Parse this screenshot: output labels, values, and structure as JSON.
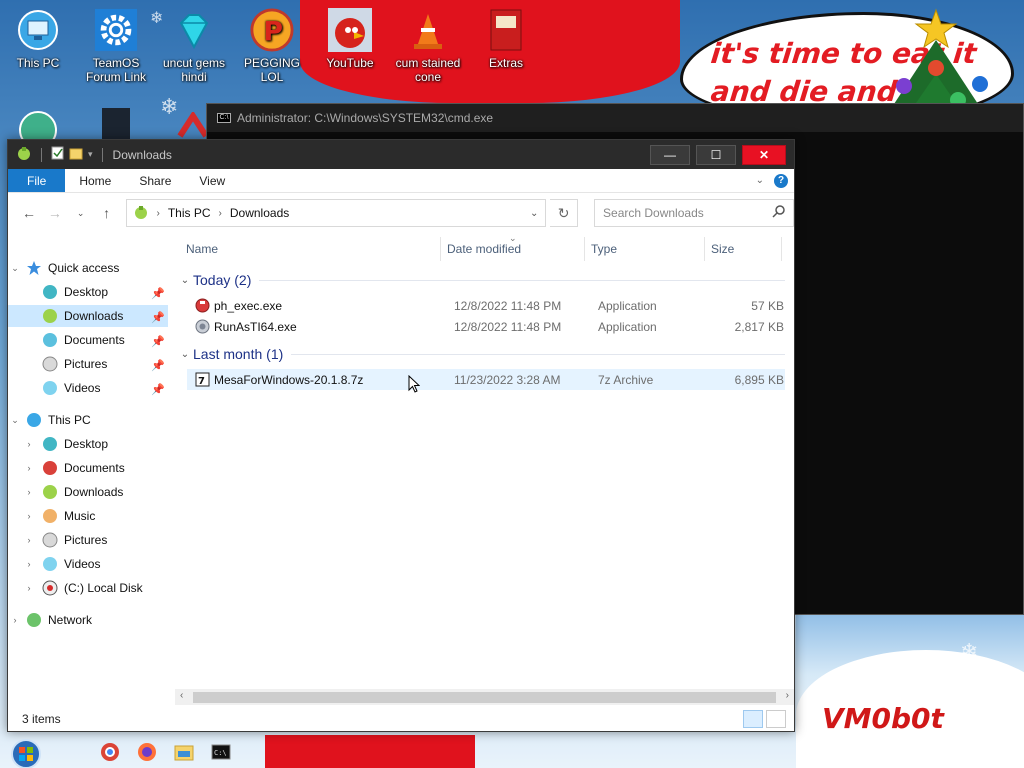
{
  "desktop": {
    "icons": [
      {
        "label": "This PC",
        "icon": "monitor-icon"
      },
      {
        "label": "TeamOS Forum Link",
        "icon": "gear-icon"
      },
      {
        "label": "uncut gems hindi",
        "icon": "diamond-icon"
      },
      {
        "label": "PEGGING LOL",
        "icon": "p-logo-icon"
      },
      {
        "label": "YouTube",
        "icon": "angry-bird-icon"
      },
      {
        "label": "cum stained cone",
        "icon": "traffic-cone-icon"
      },
      {
        "label": "Extras",
        "icon": "book-icon"
      }
    ],
    "speech_bubble": [
      "it's time to eat it",
      "and die and d"
    ],
    "signature": "VM0b0t"
  },
  "cmd_window": {
    "title": "Administrator: C:\\Windows\\SYSTEM32\\cmd.exe"
  },
  "explorer": {
    "title": "Downloads",
    "window_buttons": {
      "minimize": "—",
      "maximize": "☐",
      "close": "✕"
    },
    "ribbon_tabs": [
      "File",
      "Home",
      "Share",
      "View"
    ],
    "address": {
      "crumbs": [
        "This PC",
        "Downloads"
      ]
    },
    "search": {
      "placeholder": "Search Downloads"
    },
    "nav": {
      "quick_access": "Quick access",
      "quick_items": [
        "Desktop",
        "Downloads",
        "Documents",
        "Pictures",
        "Videos"
      ],
      "this_pc": "This PC",
      "pc_items": [
        "Desktop",
        "Documents",
        "Downloads",
        "Music",
        "Pictures",
        "Videos",
        "(C:) Local Disk"
      ],
      "network": "Network",
      "selected": "Downloads"
    },
    "columns": {
      "name": "Name",
      "date": "Date modified",
      "type": "Type",
      "size": "Size"
    },
    "groups": [
      {
        "label": "Today (2)",
        "files": [
          {
            "name": "ph_exec.exe",
            "date": "12/8/2022 11:48 PM",
            "type": "Application",
            "size": "57 KB"
          },
          {
            "name": "RunAsTI64.exe",
            "date": "12/8/2022 11:48 PM",
            "type": "Application",
            "size": "2,817 KB"
          }
        ]
      },
      {
        "label": "Last month (1)",
        "files": [
          {
            "name": "MesaForWindows-20.1.8.7z",
            "date": "11/23/2022 3:28 AM",
            "type": "7z Archive",
            "size": "6,895 KB"
          }
        ]
      }
    ],
    "status": "3 items"
  },
  "colors": {
    "accent": "#1979ca",
    "selection": "#cce8ff",
    "hover": "#e5f3ff",
    "group_text": "#1e3287",
    "close_red": "#e81123"
  }
}
